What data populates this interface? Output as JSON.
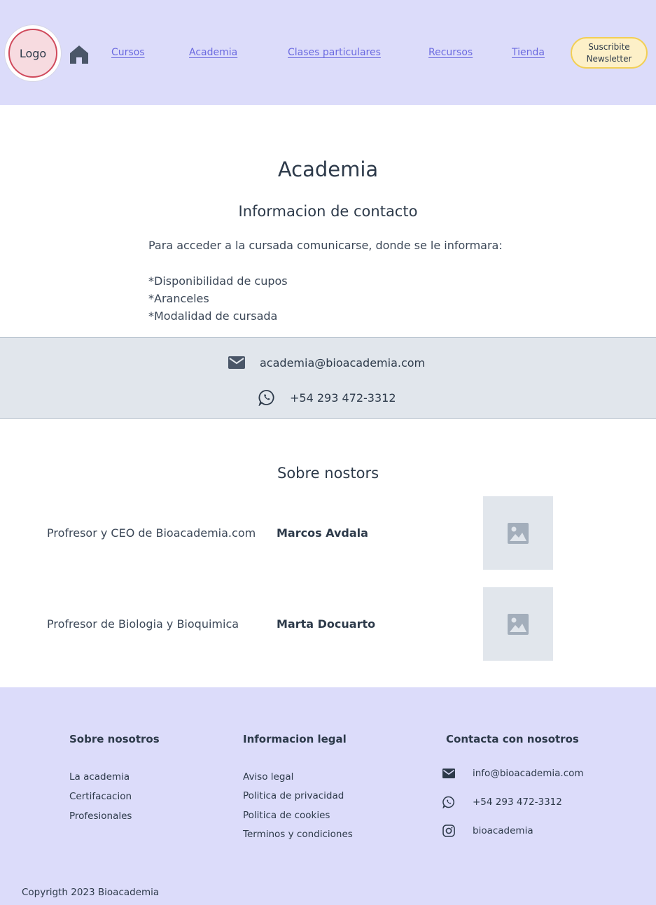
{
  "header": {
    "logo_label": "Logo",
    "nav": [
      {
        "label": "Cursos"
      },
      {
        "label": "Academia"
      },
      {
        "label": "Clases particulares"
      },
      {
        "label": "Recursos"
      },
      {
        "label": "Tienda"
      }
    ],
    "newsletter_line1": "Suscribite",
    "newsletter_line2": "Newsletter"
  },
  "main": {
    "title": "Academia",
    "subtitle": "Informacion de contacto",
    "intro": "Para acceder a la cursada comunicarse, donde se le informara:",
    "bullets": [
      "*Disponibilidad de cupos",
      "*Aranceles",
      "*Modalidad de cursada"
    ]
  },
  "contact": {
    "email": "academia@bioacademia.com",
    "phone": "+54 293 472-3312"
  },
  "about": {
    "title": "Sobre nostors",
    "members": [
      {
        "role": "Profresor y CEO de Bioacademia.com",
        "name": "Marcos Avdala"
      },
      {
        "role": "Profresor de Biologia y Bioquimica",
        "name": "Marta Docuarto"
      }
    ]
  },
  "footer": {
    "col1": {
      "heading": "Sobre nosotros",
      "links": [
        "La academia",
        "Certifacacion",
        "Profesionales"
      ]
    },
    "col2": {
      "heading": "Informacion legal",
      "links": [
        "Aviso legal",
        "Politica de privacidad",
        "Politica de cookies",
        "Terminos y condiciones"
      ]
    },
    "col3": {
      "heading": "Contacta con nosotros",
      "email": "info@bioacademia.com",
      "phone": "+54 293 472-3312",
      "instagram": "bioacademia"
    },
    "copyright": "Copyrigth 2023 Bioacademia"
  },
  "colors": {
    "header_bg": "#dcdcfa",
    "link": "#6b6ae0",
    "accent_yellow": "#fdf0c8",
    "logo_red": "#d04a5c",
    "band_gray": "#e1e6ec"
  },
  "icons": [
    "home-icon",
    "mail-icon",
    "whatsapp-icon",
    "image-placeholder-icon",
    "instagram-icon"
  ]
}
